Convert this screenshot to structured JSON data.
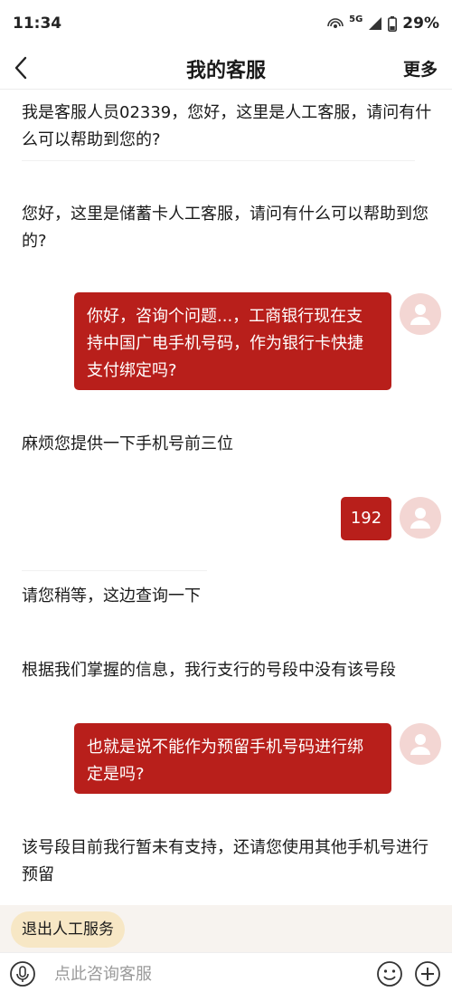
{
  "status_bar": {
    "time": "11:34",
    "network": "5G",
    "battery": "29%"
  },
  "nav": {
    "title": "我的客服",
    "more_label": "更多"
  },
  "messages": [
    {
      "side": "left",
      "text": "我是客服人员02339，您好，这里是人工客服，请问有什么可以帮助到您的?"
    },
    {
      "side": "left",
      "text": "您好，这里是储蓄卡人工客服，请问有什么可以帮助到您的?"
    },
    {
      "side": "right",
      "text": "你好，咨询个问题...，工商银行现在支持中国广电手机号码，作为银行卡快捷支付绑定吗?"
    },
    {
      "side": "left",
      "text": "麻烦您提供一下手机号前三位"
    },
    {
      "side": "right",
      "text": "192"
    },
    {
      "side": "left",
      "text": "请您稍等，这边查询一下"
    },
    {
      "side": "left",
      "text": "根据我们掌握的信息，我行支行的号段中没有该号段"
    },
    {
      "side": "right",
      "text": "也就是说不能作为预留手机号码进行绑定是吗?"
    },
    {
      "side": "left",
      "text": "该号段目前我行暂未有支持，还请您使用其他手机号进行预留"
    }
  ],
  "bottom": {
    "exit_label": "退出人工服务",
    "input_placeholder": "点此咨询客服"
  },
  "colors": {
    "user_bubble": "#b81f1b",
    "avatar_bg": "#f3d6d3",
    "exit_button_bg": "#f7e7c5"
  },
  "icons": [
    "back-arrow-icon",
    "voice-icon",
    "emoji-icon",
    "plus-icon",
    "user-avatar-icon",
    "signal-icon",
    "battery-icon",
    "hotspot-icon"
  ]
}
